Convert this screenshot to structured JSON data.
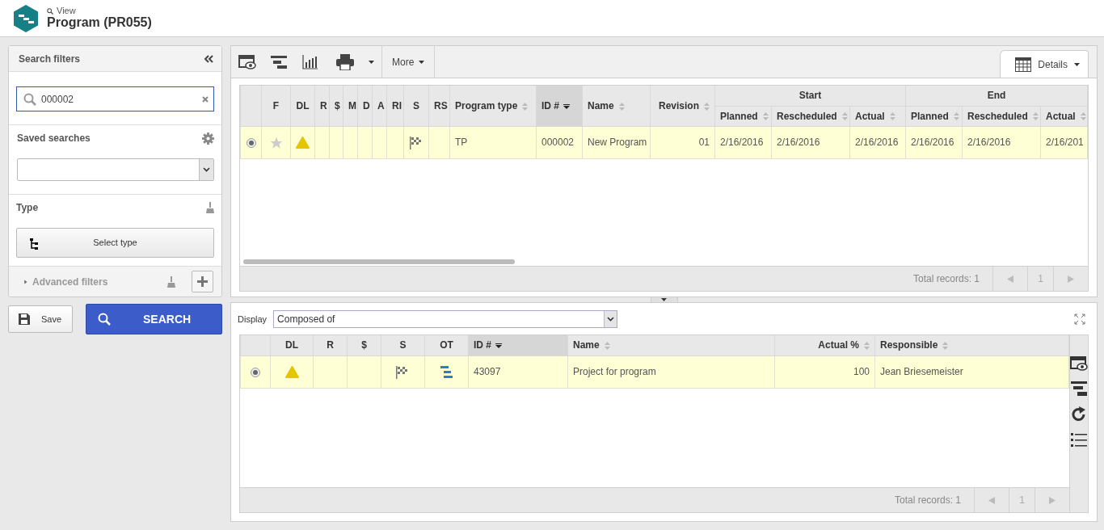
{
  "header": {
    "breadcrumb": "View",
    "title": "Program (PR055)"
  },
  "filters": {
    "title": "Search filters",
    "search": {
      "value": "000002"
    },
    "saved_searches": {
      "label": "Saved searches"
    },
    "type": {
      "label": "Type",
      "button": "Select type"
    },
    "advanced": {
      "label": "Advanced filters",
      "expanded": false
    },
    "save": "Save",
    "search_button": "SEARCH"
  },
  "top_grid": {
    "toolbar": {
      "more": "More",
      "view": "Details"
    },
    "column_groups": [
      {
        "label": "Start"
      },
      {
        "label": "End"
      }
    ],
    "columns": [
      {
        "label": "F"
      },
      {
        "label": "DL"
      },
      {
        "label": "R"
      },
      {
        "label": "$"
      },
      {
        "label": "M"
      },
      {
        "label": "D"
      },
      {
        "label": "A"
      },
      {
        "label": "RI"
      },
      {
        "label": "S"
      },
      {
        "label": "RS"
      },
      {
        "label": "Program type",
        "sortable": true,
        "sorted": false
      },
      {
        "label": "ID #",
        "sortable": true,
        "sorted": true
      },
      {
        "label": "Name",
        "sortable": true,
        "sorted": false
      },
      {
        "label": "Revision",
        "sortable": true,
        "sorted": false
      },
      {
        "label": "Planned",
        "sortable": true,
        "sorted": false
      },
      {
        "label": "Rescheduled",
        "sortable": true,
        "sorted": false
      },
      {
        "label": "Actual",
        "sortable": true,
        "sorted": false
      },
      {
        "label": "Planned",
        "sortable": true,
        "sorted": false
      },
      {
        "label": "Rescheduled",
        "sortable": true,
        "sorted": false
      },
      {
        "label": "Actual",
        "sortable": true,
        "sorted": false
      }
    ],
    "rows": [
      {
        "selected": true,
        "cells": [
          {
            "kind": "star"
          },
          {
            "kind": "warning"
          },
          null,
          null,
          null,
          null,
          null,
          null,
          {
            "kind": "flag"
          },
          null,
          "TP",
          "000002",
          "New Program",
          "01",
          "2/16/2016",
          "2/16/2016",
          "2/16/2016",
          "2/16/2016",
          "2/16/2016",
          "2/16/201"
        ]
      }
    ],
    "footer": {
      "total": "Total records: 1",
      "page": "1"
    }
  },
  "bottom_grid": {
    "display": {
      "label": "Display",
      "value": "Composed of"
    },
    "columns": [
      {
        "label": "DL"
      },
      {
        "label": "R"
      },
      {
        "label": "$"
      },
      {
        "label": "S"
      },
      {
        "label": "OT"
      },
      {
        "label": "ID #",
        "sortable": true,
        "sorted": true
      },
      {
        "label": "Name",
        "sortable": true,
        "sorted": false
      },
      {
        "label": "Actual %",
        "sortable": true,
        "sorted": false
      },
      {
        "label": "Responsible",
        "sortable": true,
        "sorted": false
      }
    ],
    "rows": [
      {
        "selected": true,
        "cells": [
          {
            "kind": "warning"
          },
          null,
          null,
          {
            "kind": "flag"
          },
          {
            "kind": "task"
          },
          "43097",
          "Project for program",
          "100",
          "Jean Briesemeister"
        ]
      }
    ],
    "footer": {
      "total": "Total records: 1",
      "page": "1"
    }
  }
}
